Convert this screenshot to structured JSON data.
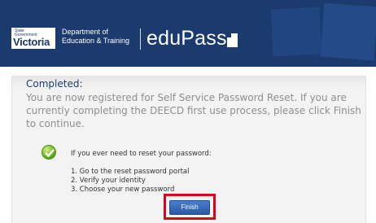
{
  "header": {
    "logo_small_line1": "State",
    "logo_small_line2": "Government",
    "logo_big": "Victoria",
    "dept_line1": "Department of",
    "dept_line2": "Education & Training",
    "brand": "eduPass",
    "colors": {
      "header_bg": "#1b3a6e",
      "accent": "#1e3d73"
    }
  },
  "main": {
    "title": "Completed:",
    "message": "You are now registered for Self Service Password Reset. If you are currently completing the DEECD first use process, please click Finish to continue.",
    "instructions_heading": "If you ever need to reset your password:",
    "steps": [
      "1.  Go to the reset password portal",
      "2.  Verify your identity",
      "3.  Choose your new password"
    ],
    "finish_label": "Finish",
    "icons": {
      "success": "check-circle-icon"
    },
    "colors": {
      "highlight": "#e0001b",
      "button": "#2a5aa6"
    }
  }
}
